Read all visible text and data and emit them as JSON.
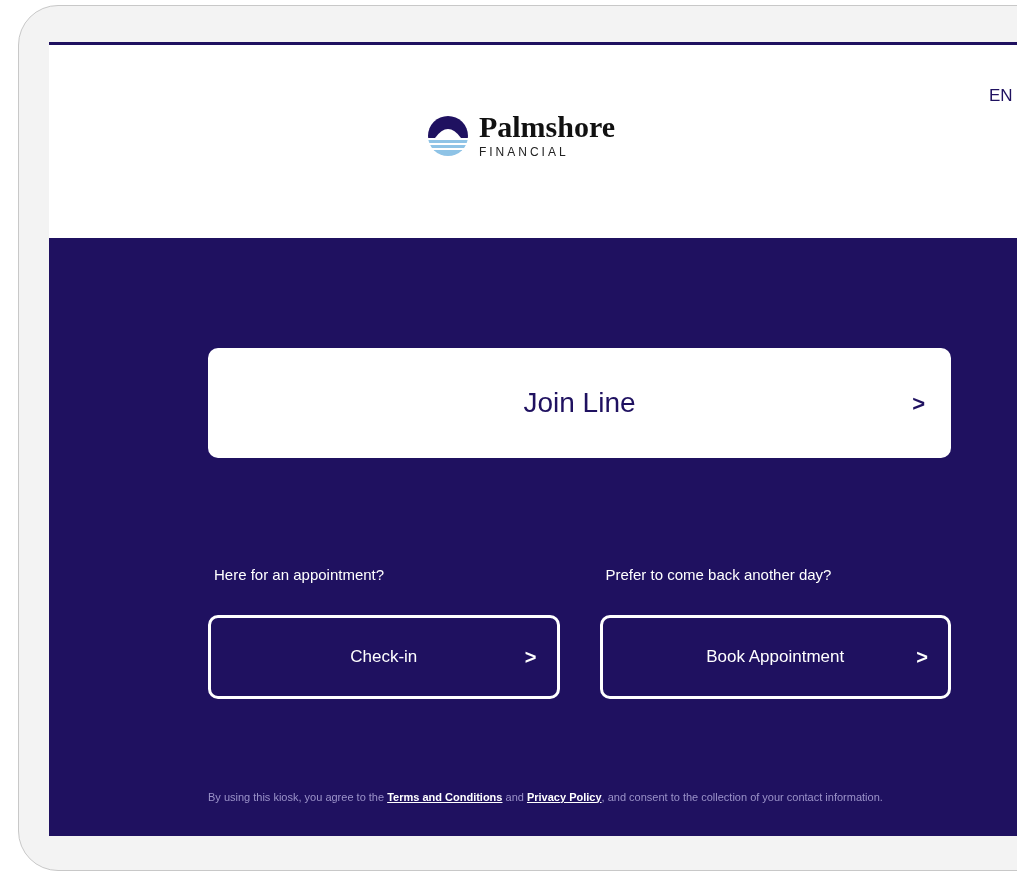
{
  "header": {
    "brand": "Palmshore",
    "brand_sub": "FINANCIAL",
    "language": "EN"
  },
  "primary_action": {
    "label": "Join Line",
    "chevron": ">"
  },
  "options": [
    {
      "prompt": "Here for an appointment?",
      "label": "Check-in",
      "chevron": ">"
    },
    {
      "prompt": "Prefer to come back another day?",
      "label": "Book Appointment",
      "chevron": ">"
    }
  ],
  "legal": [
    {
      "kind": "text",
      "text": "By using this kiosk, you agree to the "
    },
    {
      "kind": "link",
      "text": "Terms and Conditions"
    },
    {
      "kind": "text",
      "text": " and "
    },
    {
      "kind": "link",
      "text": "Privacy Policy"
    },
    {
      "kind": "text",
      "text": ", and consent to the collection of your contact information."
    }
  ]
}
